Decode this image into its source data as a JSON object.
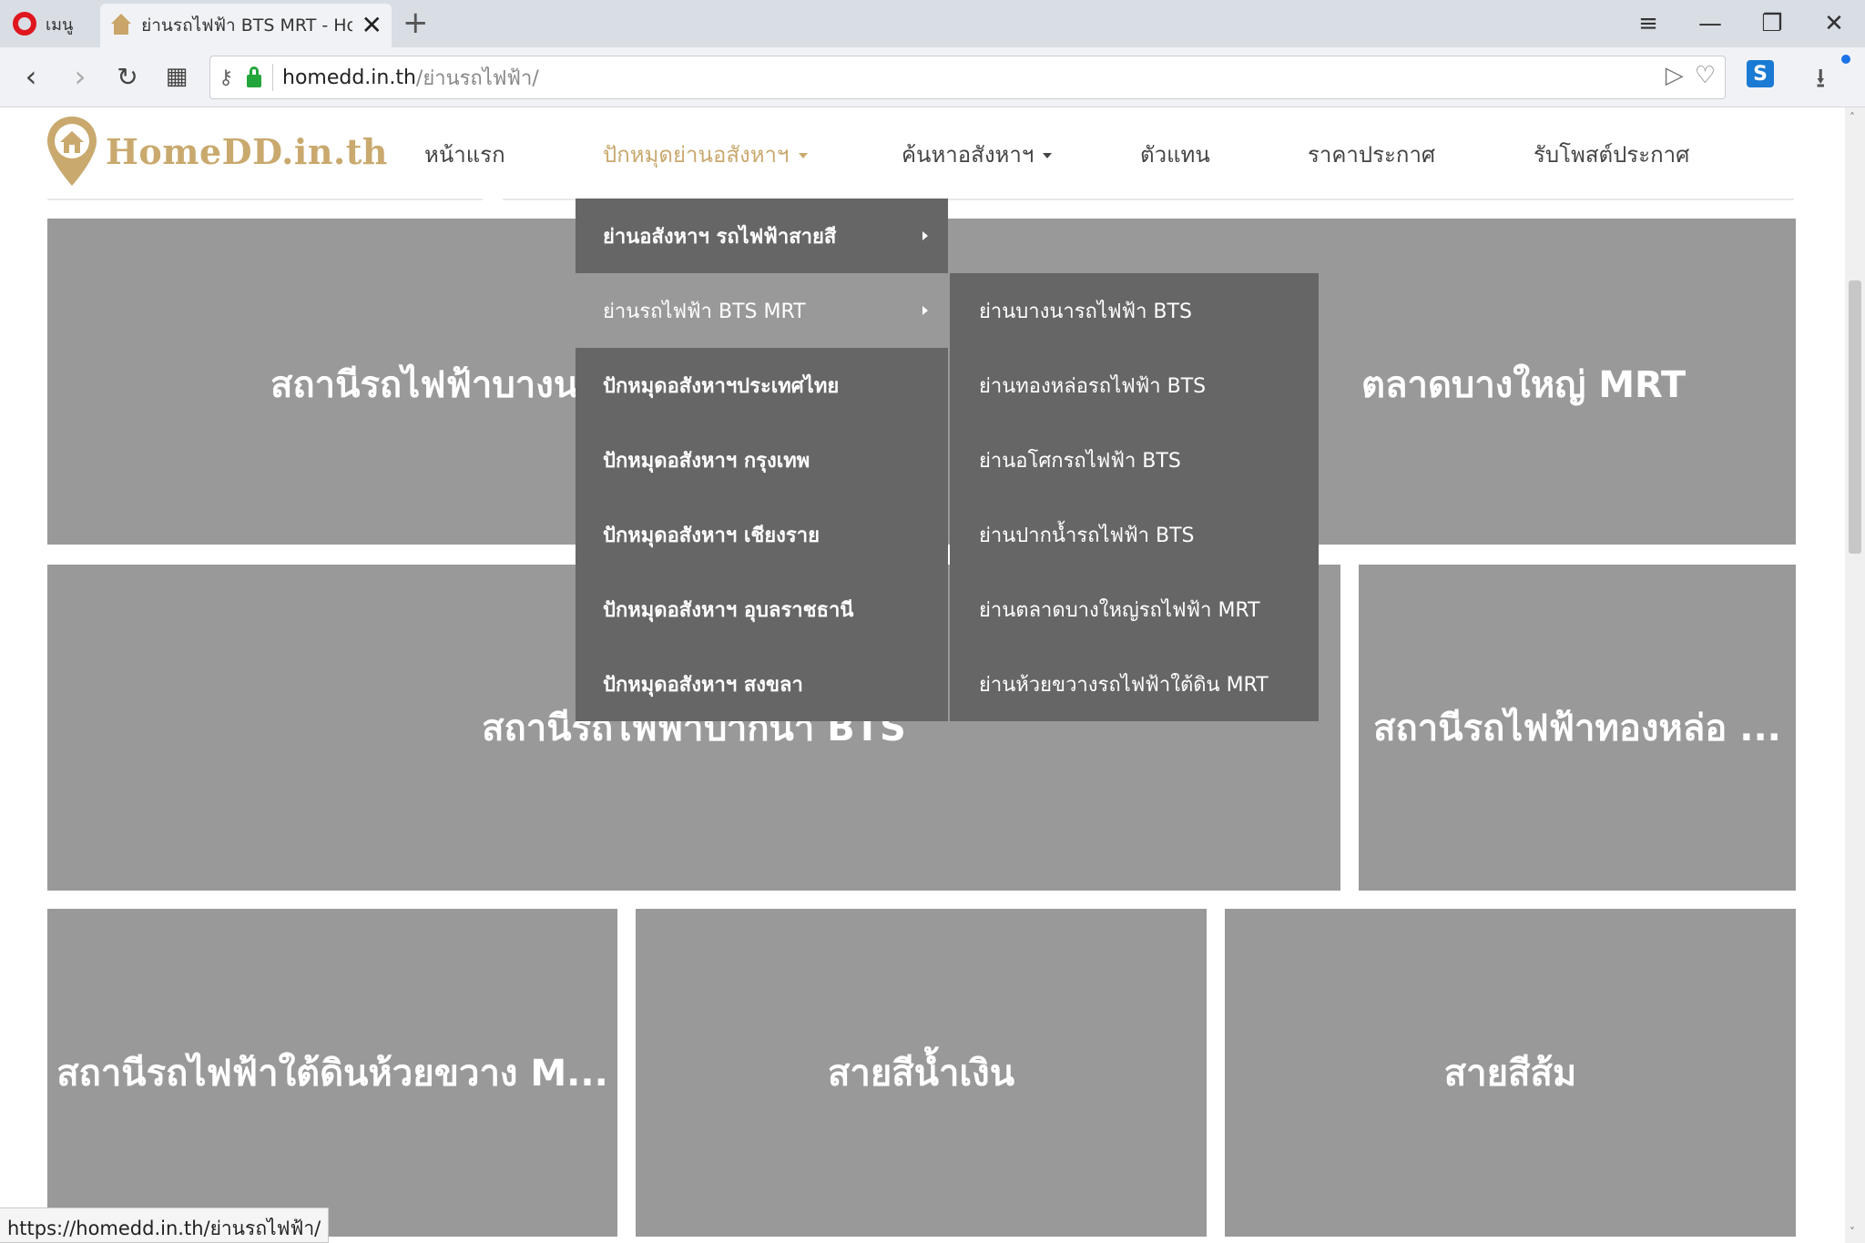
{
  "browser": {
    "menu_label": "เมนู",
    "tab_title": "ย่านรถไฟฟ้า BTS MRT - Hom",
    "tab_close": "✕",
    "new_tab": "+",
    "url_host": "homedd.in.th",
    "url_path": "/ย่านรถไฟฟ้า/",
    "back": "‹",
    "forward": "›",
    "reload": "↻",
    "speed_dial": "▦",
    "send_icon": "▷",
    "heart_icon": "♡",
    "download_icon": "⭳",
    "win_menu": "≡",
    "win_min": "—",
    "win_max": "❐",
    "win_close": "✕",
    "accent": "#e0161e"
  },
  "site": {
    "logo_text": "HomeDD.in.th",
    "brand_color": "#c9a96e",
    "nav": {
      "home": "หน้าแรก",
      "pin_area": "ปักหมุดย่านอสังหาฯ",
      "search": "ค้นหาอสังหาฯ",
      "agent": "ตัวแทน",
      "price": "ราคาประกาศ",
      "post": "รับโพสต์ประกาศ"
    },
    "dropdown": [
      {
        "label": "ย่านอสังหาฯ รถไฟฟ้าสายสี"
      },
      {
        "label": "ย่านรถไฟฟ้า BTS MRT"
      },
      {
        "label": "ปักหมุดอสังหาฯประเทศไทย"
      },
      {
        "label": "ปักหมุดอสังหาฯ กรุงเทพ"
      },
      {
        "label": "ปักหมุดอสังหาฯ เชียงราย"
      },
      {
        "label": "ปักหมุดอสังหาฯ อุบลราชธานี"
      },
      {
        "label": "ปักหมุดอสังหาฯ สงขลา"
      }
    ],
    "submenu": [
      {
        "label": "ย่านบางนารถไฟฟ้า BTS"
      },
      {
        "label": "ย่านทองหล่อรถไฟฟ้า BTS"
      },
      {
        "label": "ย่านอโศกรถไฟฟ้า BTS"
      },
      {
        "label": "ย่านปากน้ำรถไฟฟ้า BTS"
      },
      {
        "label": "ย่านตลาดบางใหญ่รถไฟฟ้า MRT"
      },
      {
        "label": "ย่านห้วยขวางรถไฟฟ้าใต้ดิน MRT"
      }
    ],
    "tiles": {
      "bangna": "สถานีรถไฟฟ้าบางน",
      "bangyai": "ตลาดบางใหญ่ MRT",
      "paknam": "สถานีรถไฟฟ้าปากน้ำ BTS",
      "thonglor": "สถานีรถไฟฟ้าทองหล่อ ...",
      "huaikhwang": "สถานีรถไฟฟ้าใต้ดินห้วยขวาง M...",
      "blue_line": "สายสีน้ำเงิน",
      "orange_line": "สายสีส้ม"
    },
    "tile_color": "#999999",
    "menu_color": "#666666"
  },
  "status_bar": {
    "url": "https://homedd.in.th/ย่านรถไฟฟ้า/"
  }
}
